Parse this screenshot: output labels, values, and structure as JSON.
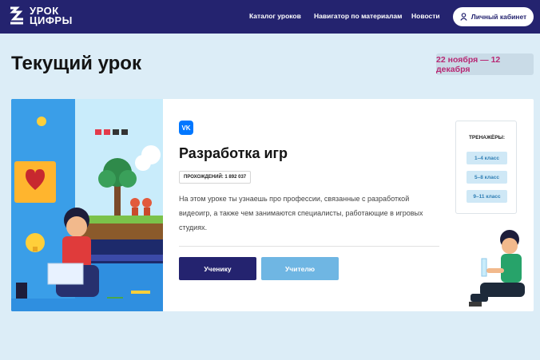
{
  "header": {
    "logo_line1": "УРОК",
    "logo_line2": "ЦИФРЫ",
    "nav": [
      "Каталог уроков",
      "Навигатор по материалам",
      "Новости"
    ],
    "cabinet_label": "Личный кабинет"
  },
  "page": {
    "title": "Текущий урок",
    "dates": "22 ноября — 12 декабря"
  },
  "lesson": {
    "brand": "VK",
    "title": "Разработка игр",
    "passes": "ПРОХОЖДЕНИЙ: 1 892 037",
    "description": "На этом уроке ты узнаешь про профессии, связанные с разработкой видеоигр, а также чем занимаются специалисты, работающие в игровых студиях.",
    "student_button": "Ученику",
    "teacher_button": "Учителю"
  },
  "trainers": {
    "title": "ТРЕНАЖЁРЫ:",
    "grades": [
      "1–4 класс",
      "5–8 класс",
      "9–11 класс"
    ]
  },
  "colors": {
    "header_bg": "#24236f",
    "page_bg": "#dcedf7",
    "date_text": "#b82874",
    "primary_button": "#24236f",
    "secondary_button": "#6fb6e3"
  }
}
